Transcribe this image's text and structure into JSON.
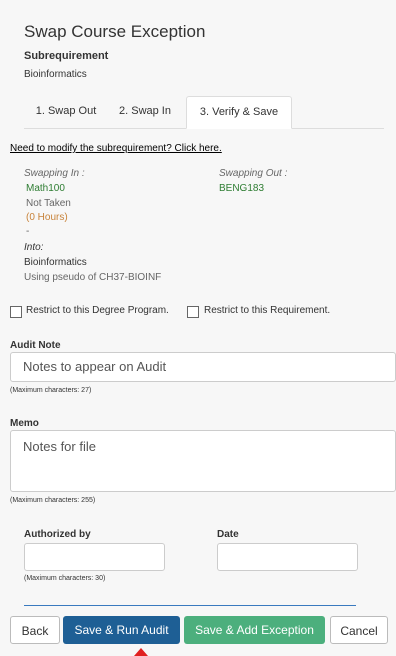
{
  "dialog": {
    "title": "Swap Course Exception",
    "subrequirement_label": "Subrequirement",
    "subrequirement_value": "Bioinformatics"
  },
  "tabs": [
    {
      "label": "1. Swap Out"
    },
    {
      "label": "2. Swap In"
    },
    {
      "label": "3. Verify & Save",
      "active": true
    }
  ],
  "modify_link": "Need to modify the subrequirement? Click here.",
  "swap": {
    "in_heading": "Swapping In :",
    "out_heading": "Swapping Out :",
    "in_course": "Math100",
    "out_course": "BENG183",
    "status": "Not Taken",
    "hours": "(0 Hours)",
    "dash": "-",
    "into_label": "Into:",
    "into_value": "Bioinformatics",
    "pseudo": "Using pseudo of CH37-BIOINF"
  },
  "checkboxes": {
    "degree_program": "Restrict to this Degree Program.",
    "requirement": "Restrict to this Requirement."
  },
  "audit_note": {
    "label": "Audit Note",
    "placeholder": "Notes to appear on Audit",
    "hint": "(Maximum characters: 27)"
  },
  "memo": {
    "label": "Memo",
    "placeholder": "Notes for file",
    "hint": "(Maximum characters: 255)"
  },
  "authorized": {
    "label": "Authorized by",
    "hint": "(Maximum characters: 30)"
  },
  "date": {
    "label": "Date"
  },
  "buttons": {
    "back": "Back",
    "save_run": "Save & Run Audit",
    "save_add": "Save & Add Exception",
    "cancel": "Cancel"
  },
  "colors": {
    "primary": "#1e5f95",
    "success": "#4caf7d",
    "course_green": "#2e7d32",
    "hours_orange": "#c8833a",
    "divider_blue": "#3a7abf",
    "pointer_red": "#e02020"
  }
}
